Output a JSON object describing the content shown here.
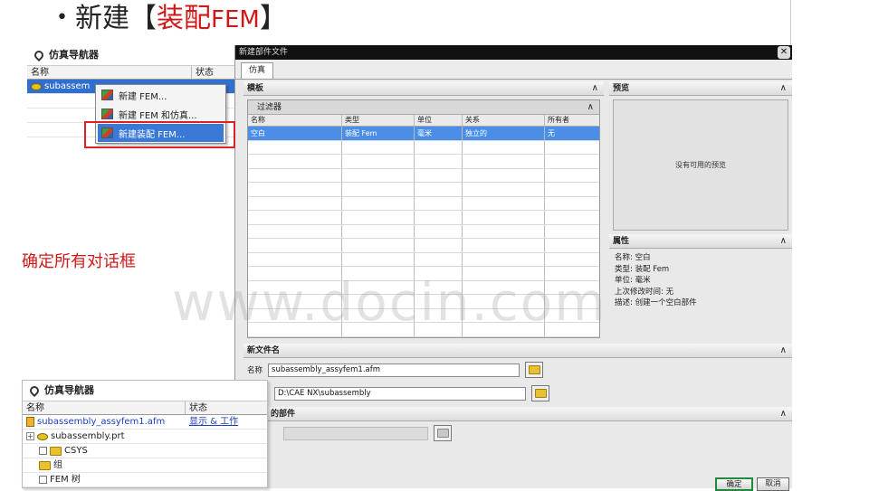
{
  "slide": {
    "bullet": "•",
    "title_prefix": "新建【",
    "title_highlight_cn": "装配",
    "title_highlight_en": "FEM",
    "title_suffix": "】",
    "note": "确定所有对话框",
    "watermark": "www.docin.com"
  },
  "navigator_top": {
    "title": "仿真导航器",
    "col_name": "名称",
    "col_status": "状态",
    "selected_row": "subassem"
  },
  "context_menu": {
    "items": [
      "新建 FEM...",
      "新建 FEM 和仿真...",
      "新建装配 FEM..."
    ]
  },
  "dialog": {
    "title": "新建部件文件",
    "close": "✕",
    "tab": "仿真",
    "templates": {
      "header": "模板",
      "filter": "过滤器",
      "columns": [
        "名称",
        "类型",
        "单位",
        "关系",
        "所有者"
      ],
      "rows": [
        [
          "空白",
          "装配 Fem",
          "毫米",
          "独立的",
          "无"
        ]
      ]
    },
    "preview": {
      "header": "预览",
      "empty_text": "没有可用的预览"
    },
    "properties": {
      "header": "属性",
      "lines": [
        "名称:  空白",
        "类型:  装配 Fem",
        "单位:  毫米",
        "上次修改时间:  无",
        "描述:  创建一个空白部件"
      ]
    },
    "new_file": {
      "header": "新文件名",
      "name_label": "名称",
      "name_value": "subassembly_assyfem1.afm",
      "folder_value": "D:\\CAE NX\\subassembly"
    },
    "part": {
      "header": "的部件"
    },
    "ok": "确定",
    "cancel": "取消"
  },
  "navigator_bottom": {
    "title": "仿真导航器",
    "col_name": "名称",
    "col_status": "状态",
    "rows": [
      {
        "name": "subassembly_assyfem1.afm",
        "status": "显示 & 工作"
      },
      {
        "name": "subassembly.prt",
        "status": ""
      },
      {
        "name": "CSYS",
        "status": ""
      },
      {
        "name": "组",
        "status": ""
      },
      {
        "name": "FEM 树",
        "status": ""
      }
    ]
  }
}
